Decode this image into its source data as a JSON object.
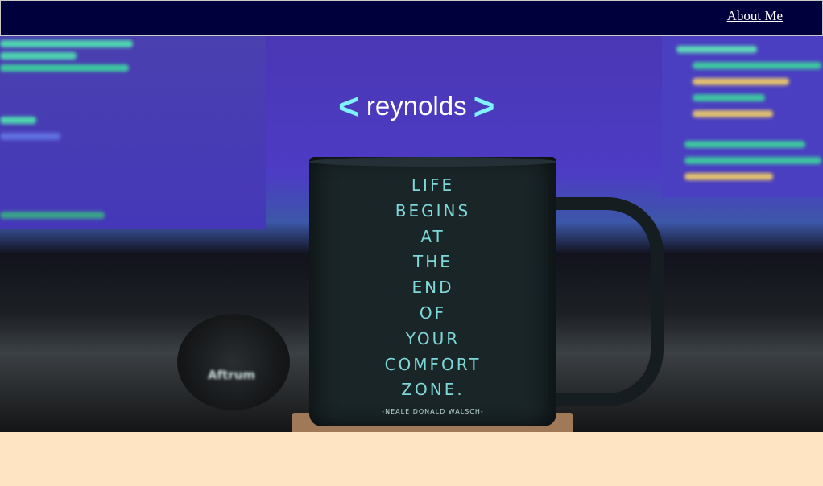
{
  "nav": {
    "about_label": "About Me"
  },
  "brand": {
    "left_bracket": "<",
    "name": "reynolds",
    "right_bracket": ">"
  },
  "hero": {
    "mug_quote": [
      "LIFE",
      "BEGINS",
      "AT",
      "THE",
      "END",
      "OF",
      "YOUR",
      "COMFORT",
      "ZONE."
    ],
    "mug_author": "-NEALE DONALD WALSCH-",
    "headphone_brand": "Aftrum"
  },
  "colors": {
    "nav_bg": "#00003c",
    "page_bg": "#ffe4c4",
    "bracket": "#7ff1ff",
    "brand_text": "#ffffff"
  },
  "footer": {
    "cropped_text": ""
  }
}
